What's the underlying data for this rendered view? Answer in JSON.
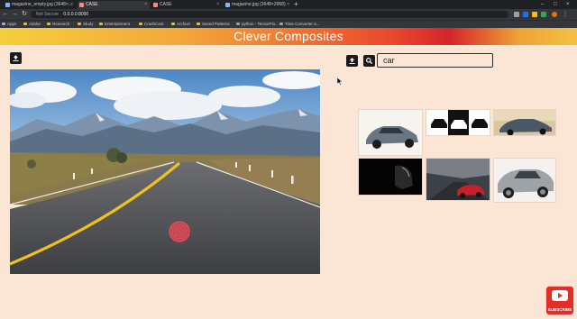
{
  "browser": {
    "tabs": [
      {
        "label": "magazine_empty.jpg (3648×...",
        "active": false
      },
      {
        "label": "CASE",
        "active": true
      },
      {
        "label": "CASE",
        "active": false
      },
      {
        "label": "magazine.jpg (3648×2968)",
        "active": false
      }
    ],
    "security_label": "Not Secure",
    "url": "0.0.0.0:8000",
    "bookmarks": [
      "Apps",
      "Adobe",
      "Research",
      "Study",
      "Entertainment",
      "CrashCast",
      "Archive",
      "Saved Patterns",
      "python - TensorFlo...",
      "Time Converter a..."
    ]
  },
  "app": {
    "title": "Clever Composites"
  },
  "search": {
    "value": "car",
    "placeholder": ""
  },
  "canvas": {
    "image": "road-landscape",
    "marker": "fingerprint-marker"
  },
  "results": [
    {
      "name": "car-result-1",
      "desc": "grey sedan"
    },
    {
      "name": "car-result-2",
      "desc": "car icons black"
    },
    {
      "name": "car-result-3",
      "desc": "car at sunset"
    },
    {
      "name": "car-result-4",
      "desc": "car in dark"
    },
    {
      "name": "car-result-5",
      "desc": "red car on road"
    },
    {
      "name": "car-result-6",
      "desc": "silver hatchback"
    }
  ],
  "subscribe_label": "SUBSCRIBE"
}
